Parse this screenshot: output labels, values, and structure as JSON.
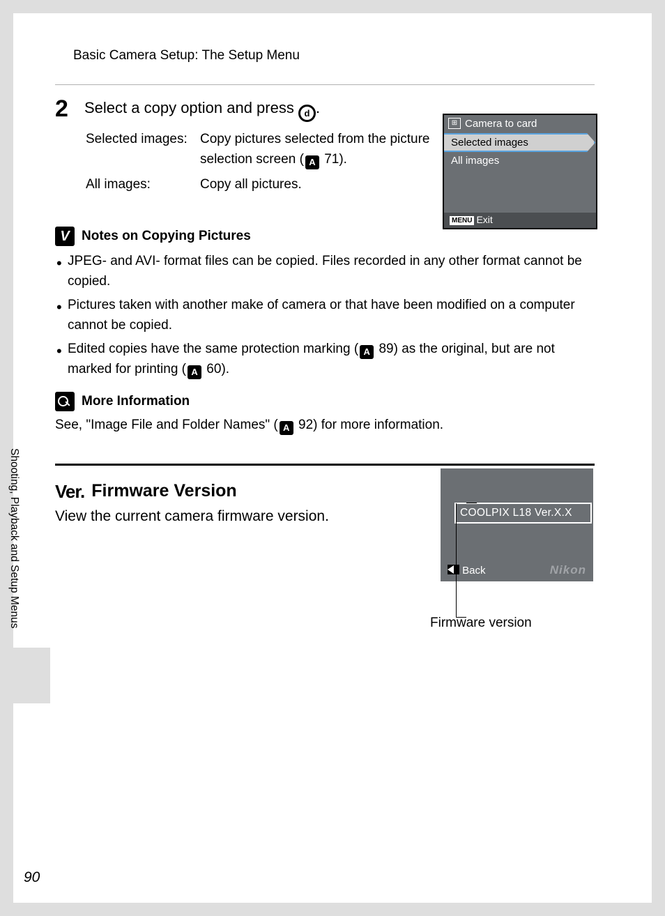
{
  "header": "Basic Camera Setup: The Setup Menu",
  "step": {
    "number": "2",
    "title_before": "Select a copy option and press ",
    "title_after": ".",
    "ok_label": "d",
    "defs": [
      {
        "term": "Selected images:",
        "desc_before": "Copy pictures selected from the picture selection screen (",
        "ref": "71",
        "desc_after": ")."
      },
      {
        "term": "All images:",
        "desc_before": "Copy all pictures.",
        "ref": "",
        "desc_after": ""
      }
    ]
  },
  "cam1": {
    "title": "Camera to card",
    "items": [
      "Selected images",
      "All images"
    ],
    "menu": "MENU",
    "exit": "Exit"
  },
  "notes": {
    "title": "Notes on Copying Pictures",
    "items": [
      {
        "t1": "JPEG- and AVI- format files can be copied. Files recorded in any other format cannot be copied."
      },
      {
        "t1": "Pictures taken with another make of camera or that have been modified on a computer cannot be copied."
      },
      {
        "t1": "Edited copies have the same protection marking (",
        "r1": "89",
        "t2": ") as the original, but are not marked for printing (",
        "r2": "60",
        "t3": ")."
      }
    ]
  },
  "info": {
    "title": "More Information",
    "text_before": "See, \"Image File and Folder Names\" (",
    "ref": "92",
    "text_after": ") for more information."
  },
  "firmware": {
    "ver_label": "Ver.",
    "heading": "Firmware Version",
    "desc": "View the current camera firmware version.",
    "box": "COOLPIX L18 Ver.X.X",
    "back": "Back",
    "brand": "Nikon",
    "callout": "Firmware version"
  },
  "side_tab": "Shooting, Playback and Setup Menus",
  "page_number": "90"
}
